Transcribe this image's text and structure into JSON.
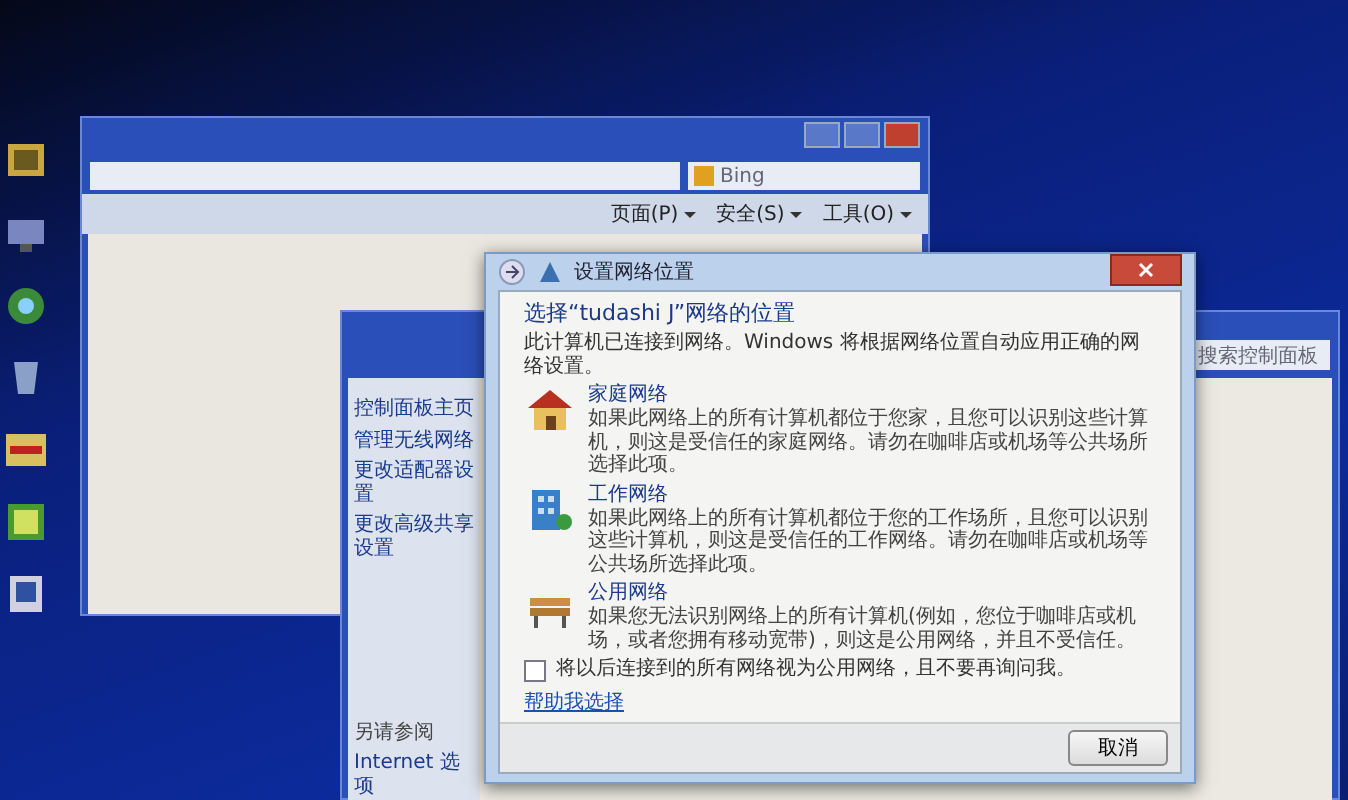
{
  "ie_window": {
    "search_placeholder": "Bing",
    "toolbar": [
      "页面(P)",
      "安全(S)",
      "工具(O)"
    ]
  },
  "control_panel": {
    "search_placeholder": "搜索控制面板",
    "tasks": [
      "控制面板主页",
      "管理无线网络",
      "更改适配器设置",
      "更改高级共享设置"
    ],
    "see_also_title": "另请参阅",
    "see_also": [
      "Internet 选项"
    ]
  },
  "dialog": {
    "title": "设置网络位置",
    "heading": "选择“tudashi J”网络的位置",
    "intro": "此计算机已连接到网络。Windows 将根据网络位置自动应用正确的网络设置。",
    "options": [
      {
        "kind": "home",
        "title": "家庭网络",
        "description": "如果此网络上的所有计算机都位于您家，且您可以识别这些计算机，则这是受信任的家庭网络。请勿在咖啡店或机场等公共场所选择此项。"
      },
      {
        "kind": "work",
        "title": "工作网络",
        "description": "如果此网络上的所有计算机都位于您的工作场所，且您可以识别这些计算机，则这是受信任的工作网络。请勿在咖啡店或机场等公共场所选择此项。"
      },
      {
        "kind": "public",
        "title": "公用网络",
        "description": "如果您无法识别网络上的所有计算机(例如，您位于咖啡店或机场，或者您拥有移动宽带)，则这是公用网络，并且不受信任。"
      }
    ],
    "checkbox": {
      "label": "将以后连接到的所有网络视为公用网络，且不要再询问我。",
      "checked": false
    },
    "link": "帮助我选择",
    "buttons": [
      "取消"
    ]
  }
}
